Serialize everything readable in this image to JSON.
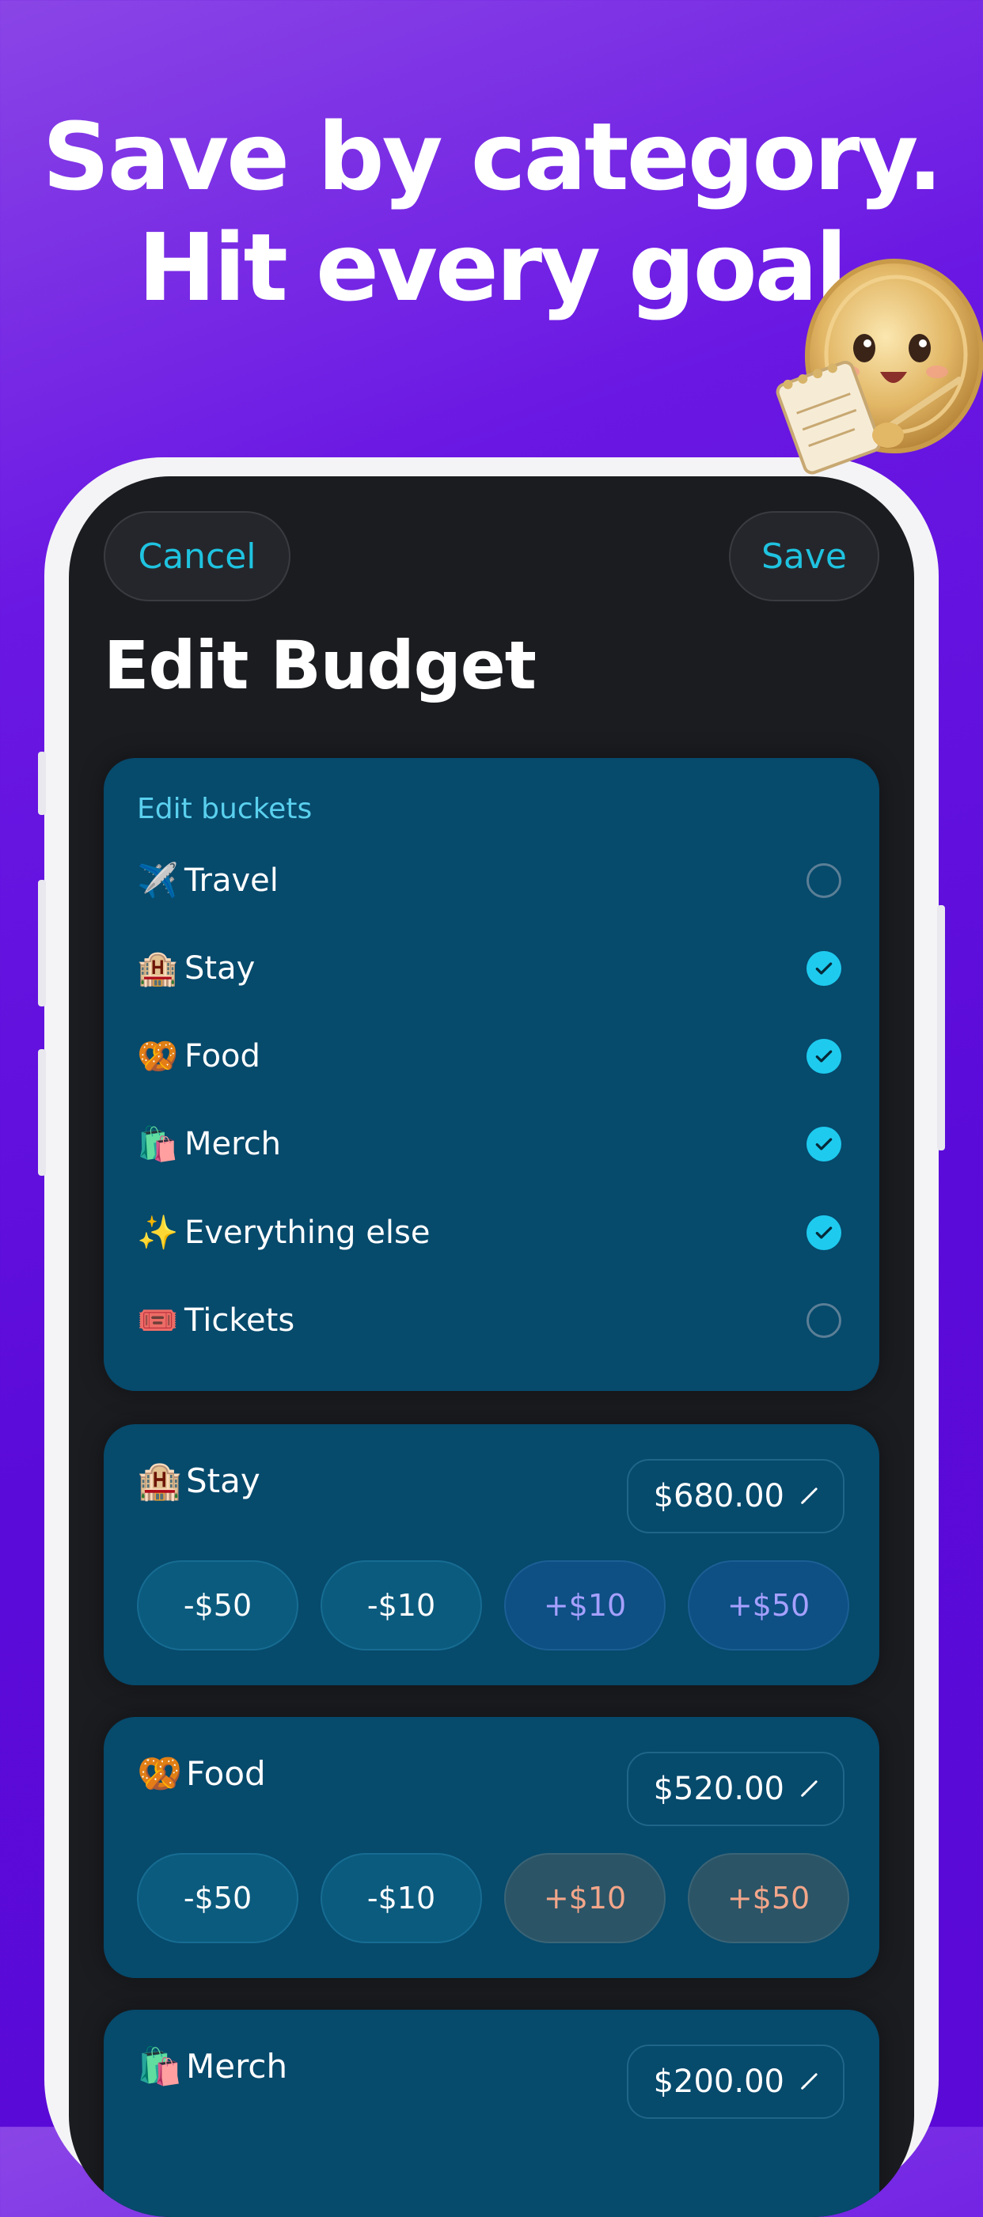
{
  "headline": {
    "line1": "Save by category.",
    "line2": "Hit every goal"
  },
  "header": {
    "cancel_label": "Cancel",
    "save_label": "Save",
    "title": "Edit Budget"
  },
  "buckets": {
    "section_label": "Edit buckets",
    "items": [
      {
        "emoji": "✈️",
        "label": "Travel",
        "checked": false
      },
      {
        "emoji": "🏨",
        "label": "Stay",
        "checked": true
      },
      {
        "emoji": "🥨",
        "label": "Food",
        "checked": true
      },
      {
        "emoji": "🛍️",
        "label": "Merch",
        "checked": true
      },
      {
        "emoji": "✨",
        "label": "Everything else",
        "checked": true
      },
      {
        "emoji": "🎟️",
        "label": "Tickets",
        "checked": false
      }
    ]
  },
  "budgets": [
    {
      "emoji": "🏨",
      "label": "Stay",
      "amount": "$680.00",
      "steps": [
        "-$50",
        "-$10",
        "+$10",
        "+$50"
      ]
    },
    {
      "emoji": "🥨",
      "label": "Food",
      "amount": "$520.00",
      "steps": [
        "-$50",
        "-$10",
        "+$10",
        "+$50"
      ]
    },
    {
      "emoji": "🛍️",
      "label": "Merch",
      "amount": "$200.00"
    }
  ],
  "colors": {
    "accent": "#1fc3e0",
    "card": "#064a6c",
    "background": "#5b0bd9"
  }
}
